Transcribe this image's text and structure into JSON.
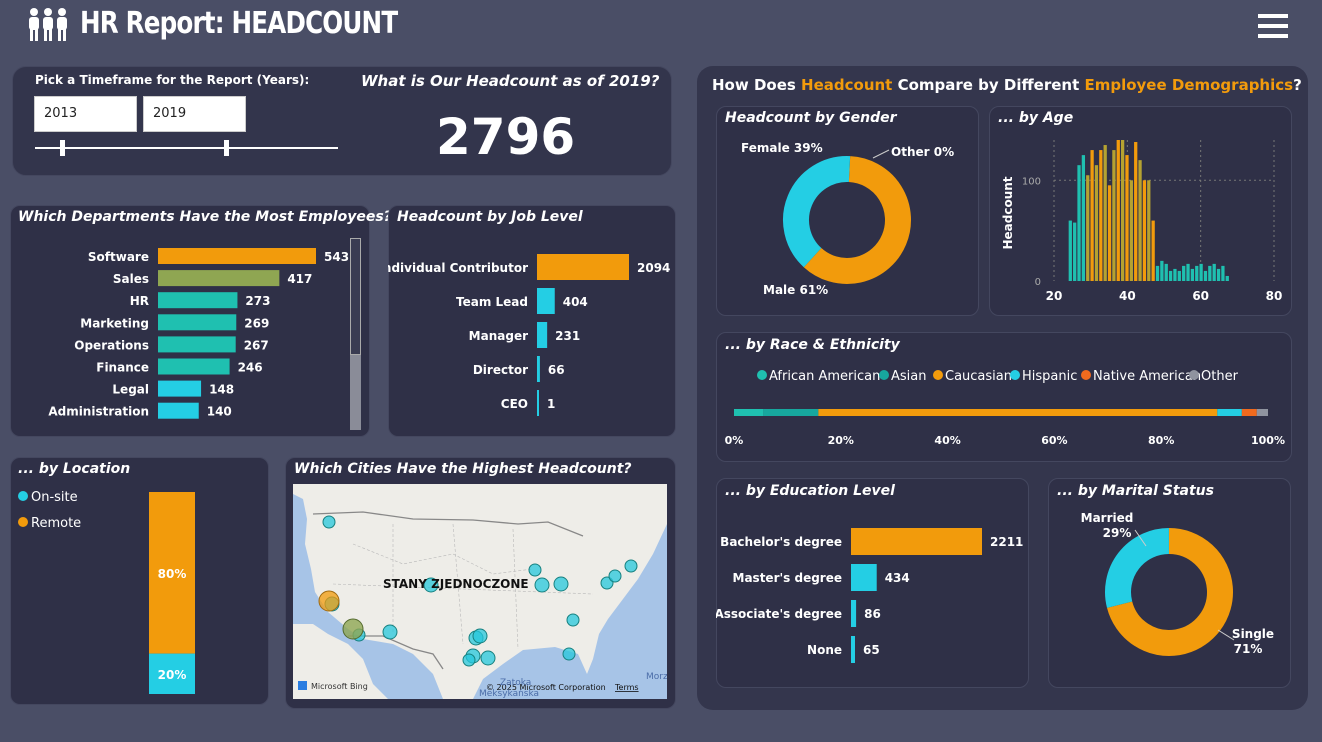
{
  "header": {
    "title": "HR Report: HEADCOUNT"
  },
  "timeframe": {
    "label": "Pick a Timeframe for the Report (Years):",
    "from": "2013",
    "to": "2019",
    "slider_start_fraction": 0.09,
    "slider_end_fraction": 0.63
  },
  "kpi": {
    "question": "What is Our Headcount as of 2019?",
    "value": "2796"
  },
  "demographics": {
    "title_pre": "How Does ",
    "title_h1": "Headcount",
    "title_mid": " Compare by Different ",
    "title_h2": "Employee Demographics",
    "title_post": "?"
  },
  "colors": {
    "orange": "#f29b0c",
    "teal": "#1fc0b0",
    "cyan": "#24cee4",
    "olive": "#8fa652",
    "gold": "#b5a231",
    "native": "#f06a1e",
    "gray": "#8f939f"
  },
  "departments": {
    "title": "Which Departments Have the Most Employees?",
    "items": [
      {
        "name": "Software",
        "value": 543
      },
      {
        "name": "Sales",
        "value": 417
      },
      {
        "name": "HR",
        "value": 273
      },
      {
        "name": "Marketing",
        "value": 269
      },
      {
        "name": "Operations",
        "value": 267
      },
      {
        "name": "Finance",
        "value": 246
      },
      {
        "name": "Legal",
        "value": 148
      },
      {
        "name": "Administration",
        "value": 140
      }
    ]
  },
  "job_level": {
    "title": "Headcount by Job Level",
    "items": [
      {
        "name": "Individual Contributor",
        "value": 2094
      },
      {
        "name": "Team Lead",
        "value": 404
      },
      {
        "name": "Manager",
        "value": 231
      },
      {
        "name": "Director",
        "value": 66
      },
      {
        "name": "CEO",
        "value": 1
      }
    ]
  },
  "gender": {
    "title": "Headcount by Gender",
    "female_label": "Female 39%",
    "other_label": "Other 0%",
    "male_label": "Male 61%",
    "female_pct": 39,
    "other_pct": 0,
    "male_pct": 61
  },
  "age": {
    "title": "... by Age",
    "ylabel": "Headcount",
    "y_ticks": [
      "100",
      "0"
    ],
    "x_ticks": [
      "20",
      "40",
      "60",
      "80"
    ],
    "ylim": [
      0,
      140
    ],
    "xlim": [
      20,
      80
    ],
    "values": [
      60,
      58,
      115,
      125,
      105,
      130,
      115,
      130,
      135,
      95,
      130,
      140,
      140,
      125,
      100,
      138,
      120,
      100,
      100,
      60,
      15,
      20,
      17,
      10,
      12,
      10,
      15,
      17,
      12,
      15,
      17,
      10,
      15,
      17,
      12,
      15,
      5
    ]
  },
  "race": {
    "title": "... by Race & Ethnicity",
    "legend": [
      "African American",
      "Asian",
      "Caucasian",
      "Hispanic",
      "Native American",
      "Other"
    ],
    "pcts": [
      5.5,
      10.3,
      74.7,
      4.6,
      2.8,
      2.1
    ],
    "ticks": [
      "0%",
      "20%",
      "40%",
      "60%",
      "80%",
      "100%"
    ]
  },
  "location": {
    "title": "... by Location",
    "legend": [
      "On-site",
      "Remote"
    ],
    "onsite_pct": 20,
    "remote_pct": 80,
    "onsite_label": "20%",
    "remote_label": "80%"
  },
  "cities": {
    "title": "Which Cities Have the Highest Headcount?",
    "country": "STANY ZJEDNOCZONE",
    "bing": "Microsoft Bing",
    "copyright": "© 2025 Microsoft Corporation",
    "terms": "Terms",
    "gulf1": "Zatoka",
    "gulf2": "Meksykańska",
    "sea": "Morz"
  },
  "education": {
    "title": "... by Education Level",
    "items": [
      {
        "name": "Bachelor's degree",
        "value": 2211
      },
      {
        "name": "Master's degree",
        "value": 434
      },
      {
        "name": "Associate's degree",
        "value": 86
      },
      {
        "name": "None",
        "value": 65
      }
    ]
  },
  "marital": {
    "title": "... by Marital Status",
    "married_label": "Married",
    "married_pct_label": "29%",
    "single_label": "Single",
    "single_pct_label": "71%",
    "married_pct": 29,
    "single_pct": 71
  }
}
